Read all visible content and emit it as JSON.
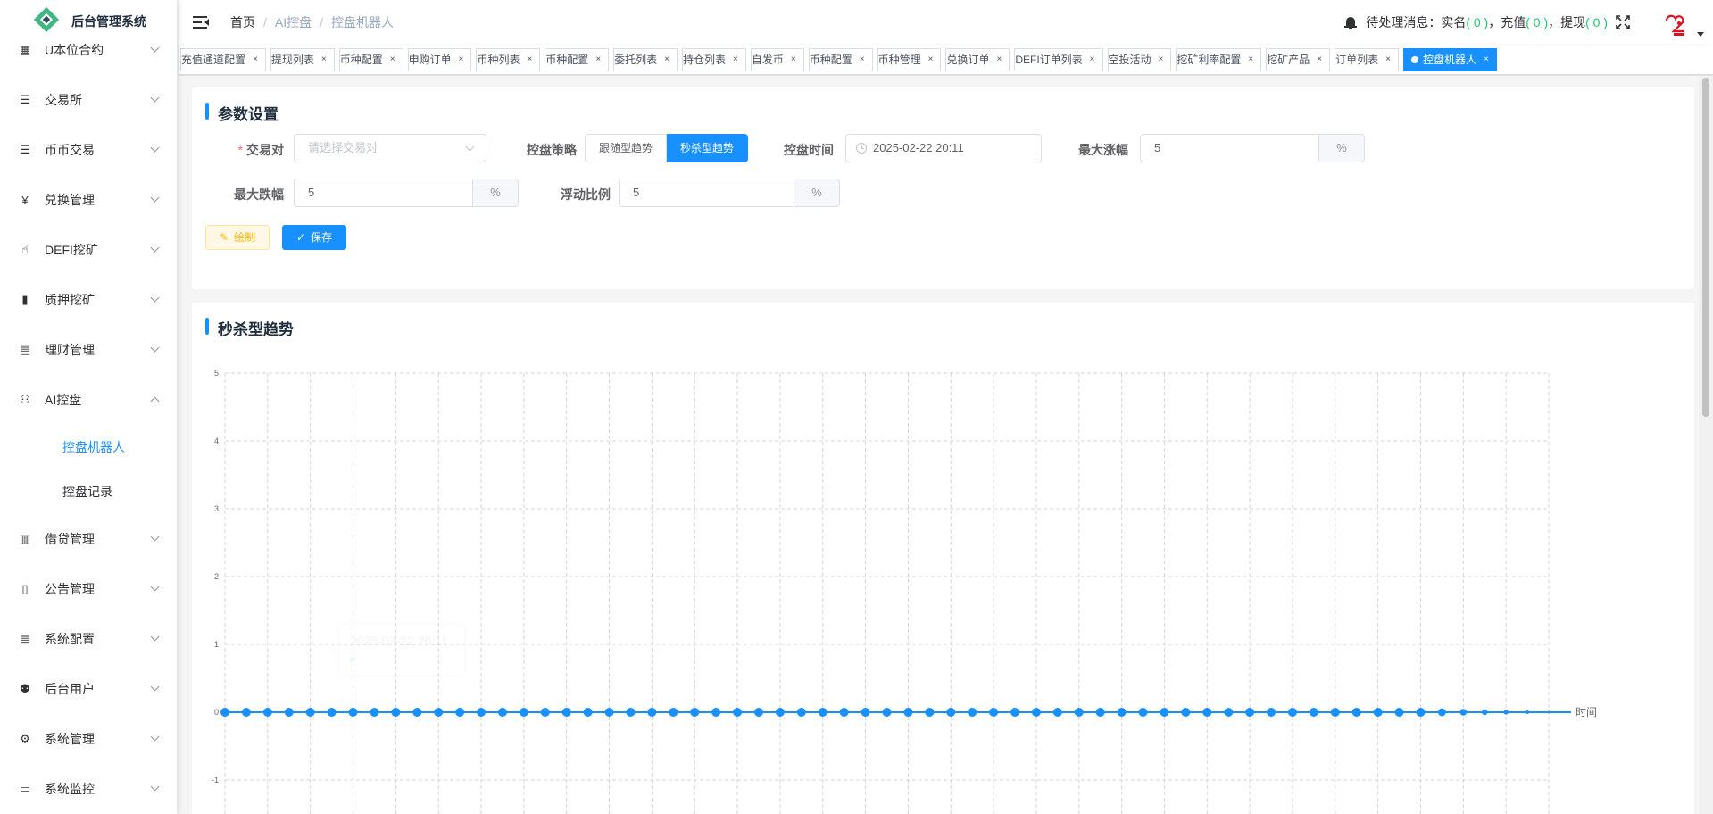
{
  "app": {
    "title": "后台管理系统"
  },
  "sidebar": {
    "items": [
      {
        "label": "U本位合约",
        "icon": "grid-icon",
        "expanded": false
      },
      {
        "label": "交易所",
        "icon": "list-icon",
        "expanded": false
      },
      {
        "label": "币币交易",
        "icon": "list-icon",
        "expanded": false
      },
      {
        "label": "兑换管理",
        "icon": "yen-icon",
        "expanded": false
      },
      {
        "label": "DEFI挖矿",
        "icon": "hand-icon",
        "expanded": false
      },
      {
        "label": "质押挖矿",
        "icon": "bar-chart-icon",
        "expanded": false
      },
      {
        "label": "理财管理",
        "icon": "document-icon",
        "expanded": false
      },
      {
        "label": "AI控盘",
        "icon": "robot-icon",
        "expanded": true,
        "children": [
          {
            "label": "控盘机器人",
            "active": true
          },
          {
            "label": "控盘记录",
            "active": false
          }
        ]
      },
      {
        "label": "借贷管理",
        "icon": "book-icon",
        "expanded": false
      },
      {
        "label": "公告管理",
        "icon": "open-book-icon",
        "expanded": false
      },
      {
        "label": "系统配置",
        "icon": "document-icon",
        "expanded": false
      },
      {
        "label": "后台用户",
        "icon": "users-icon",
        "expanded": false
      },
      {
        "label": "系统管理",
        "icon": "gear-icon",
        "expanded": false
      },
      {
        "label": "系统监控",
        "icon": "monitor-icon",
        "expanded": false
      }
    ]
  },
  "header": {
    "breadcrumb": [
      "首页",
      "AI控盘",
      "控盘机器人"
    ],
    "notice": {
      "prefix": "待处理消息：",
      "items": [
        {
          "label": "实名",
          "count": "( 0 )"
        },
        {
          "label": "充值",
          "count": "( 0 )"
        },
        {
          "label": "提现",
          "count": "( 0 )"
        }
      ],
      "sep": "，"
    }
  },
  "tags": [
    {
      "label": "充值通道配置",
      "active": false
    },
    {
      "label": "提现列表",
      "active": false
    },
    {
      "label": "币种配置",
      "active": false
    },
    {
      "label": "申购订单",
      "active": false
    },
    {
      "label": "币种列表",
      "active": false
    },
    {
      "label": "币种配置",
      "active": false
    },
    {
      "label": "委托列表",
      "active": false
    },
    {
      "label": "持仓列表",
      "active": false
    },
    {
      "label": "自发币",
      "active": false
    },
    {
      "label": "币种配置",
      "active": false
    },
    {
      "label": "币种管理",
      "active": false
    },
    {
      "label": "兑换订单",
      "active": false
    },
    {
      "label": "DEFI订单列表",
      "active": false
    },
    {
      "label": "空投活动",
      "active": false
    },
    {
      "label": "挖矿利率配置",
      "active": false
    },
    {
      "label": "挖矿产品",
      "active": false
    },
    {
      "label": "订单列表",
      "active": false
    },
    {
      "label": "控盘机器人",
      "active": true
    }
  ],
  "tag_close": "×",
  "params": {
    "title": "参数设置",
    "pair_label": "交易对",
    "pair_required": "*",
    "pair_placeholder": "请选择交易对",
    "strategy_label": "控盘策略",
    "strategy_options": [
      "跟随型趋势",
      "秒杀型趋势"
    ],
    "strategy_selected": "秒杀型趋势",
    "time_label": "控盘时间",
    "time_value": "2025-02-22 20:11",
    "max_rise_label": "最大涨幅",
    "max_rise_value": "5",
    "max_fall_label": "最大跌幅",
    "max_fall_value": "5",
    "float_label": "浮动比例",
    "float_value": "5",
    "unit": "%",
    "draw_label": "绘制",
    "save_label": "保存"
  },
  "chart_section": {
    "title": "秒杀型趋势"
  },
  "chart_data": {
    "type": "line",
    "title": "",
    "xlabel": "时间",
    "ylabel": "",
    "ylim": [
      -1,
      5
    ],
    "yticks": [
      -1,
      0,
      1,
      2,
      3,
      4,
      5
    ],
    "grid": true,
    "series": [
      {
        "values": [
          0,
          0,
          0,
          0,
          0,
          0,
          0,
          0,
          0,
          0,
          0,
          0,
          0,
          0,
          0,
          0,
          0,
          0,
          0,
          0,
          0,
          0,
          0,
          0,
          0,
          0,
          0,
          0,
          0,
          0,
          0,
          0,
          0,
          0,
          0,
          0,
          0,
          0,
          0,
          0,
          0,
          0,
          0,
          0,
          0,
          0,
          0,
          0,
          0,
          0,
          0,
          0,
          0,
          0,
          0,
          0,
          0,
          0,
          0,
          0,
          0,
          0,
          0
        ],
        "color": "#1890ff"
      }
    ]
  }
}
